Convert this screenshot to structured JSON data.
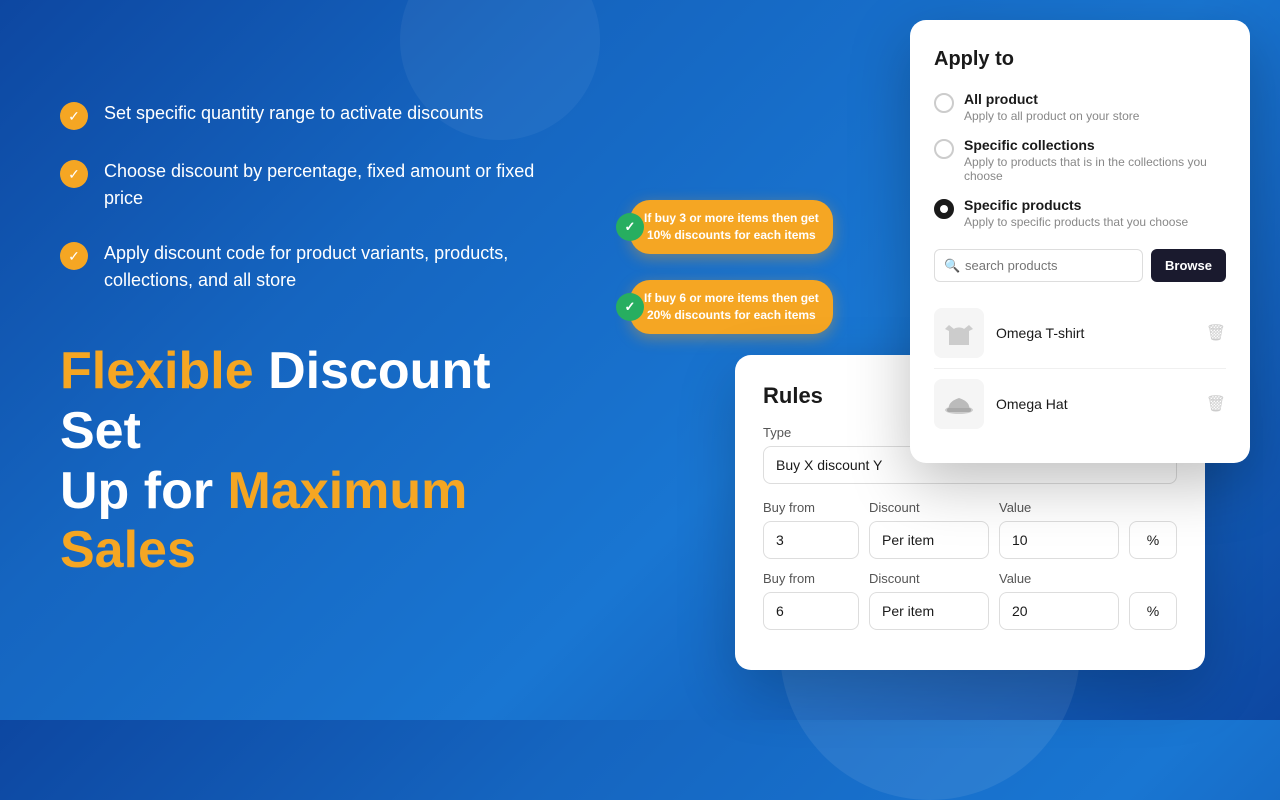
{
  "background": {
    "gradient_start": "#0d47a1",
    "gradient_end": "#1565c0"
  },
  "features": {
    "items": [
      {
        "id": "feature-1",
        "text": "Set specific quantity range to activate discounts"
      },
      {
        "id": "feature-2",
        "text": "Choose discount by percentage, fixed amount or fixed price"
      },
      {
        "id": "feature-3",
        "text": "Apply discount code for product variants, products, collections, and all store"
      }
    ]
  },
  "headline": {
    "line1_prefix": "Flexible ",
    "line1_highlight": "Discount Set",
    "line2_prefix": "Up for ",
    "line2_highlight": "Maximum",
    "line3": "Sales"
  },
  "apply_to_card": {
    "title": "Apply to",
    "options": [
      {
        "id": "all-product",
        "label": "All product",
        "sublabel": "Apply to all product on your store",
        "selected": false
      },
      {
        "id": "specific-collections",
        "label": "Specific collections",
        "sublabel": "Apply to products that is in the collections you choose",
        "selected": false
      },
      {
        "id": "specific-products",
        "label": "Specific products",
        "sublabel": "Apply to specific products that you choose",
        "selected": true
      }
    ],
    "search_placeholder": "search products",
    "browse_label": "Browse",
    "products": [
      {
        "id": "omega-tshirt",
        "name": "Omega T-shirt",
        "icon": "tshirt"
      },
      {
        "id": "omega-hat",
        "name": "Omega Hat",
        "icon": "hat"
      }
    ]
  },
  "badges": [
    {
      "id": "badge1",
      "text": "If buy 3 or more items then get\n10% discounts for each items"
    },
    {
      "id": "badge2",
      "text": "If buy 6 or more items then get\n20% discounts for each items"
    }
  ],
  "rules_card": {
    "title": "Rules",
    "type_label": "Type",
    "type_value": "Buy X discount Y",
    "rows": [
      {
        "buy_from_label": "Buy from",
        "buy_from_value": "3",
        "discount_label": "Discount",
        "discount_value": "Per item",
        "value_label": "Value",
        "value_value": "10",
        "pct_value": "%"
      },
      {
        "buy_from_label": "Buy from",
        "buy_from_value": "6",
        "discount_label": "Discount",
        "discount_value": "Per item",
        "value_label": "Value",
        "value_value": "20",
        "pct_value": "%"
      }
    ]
  }
}
